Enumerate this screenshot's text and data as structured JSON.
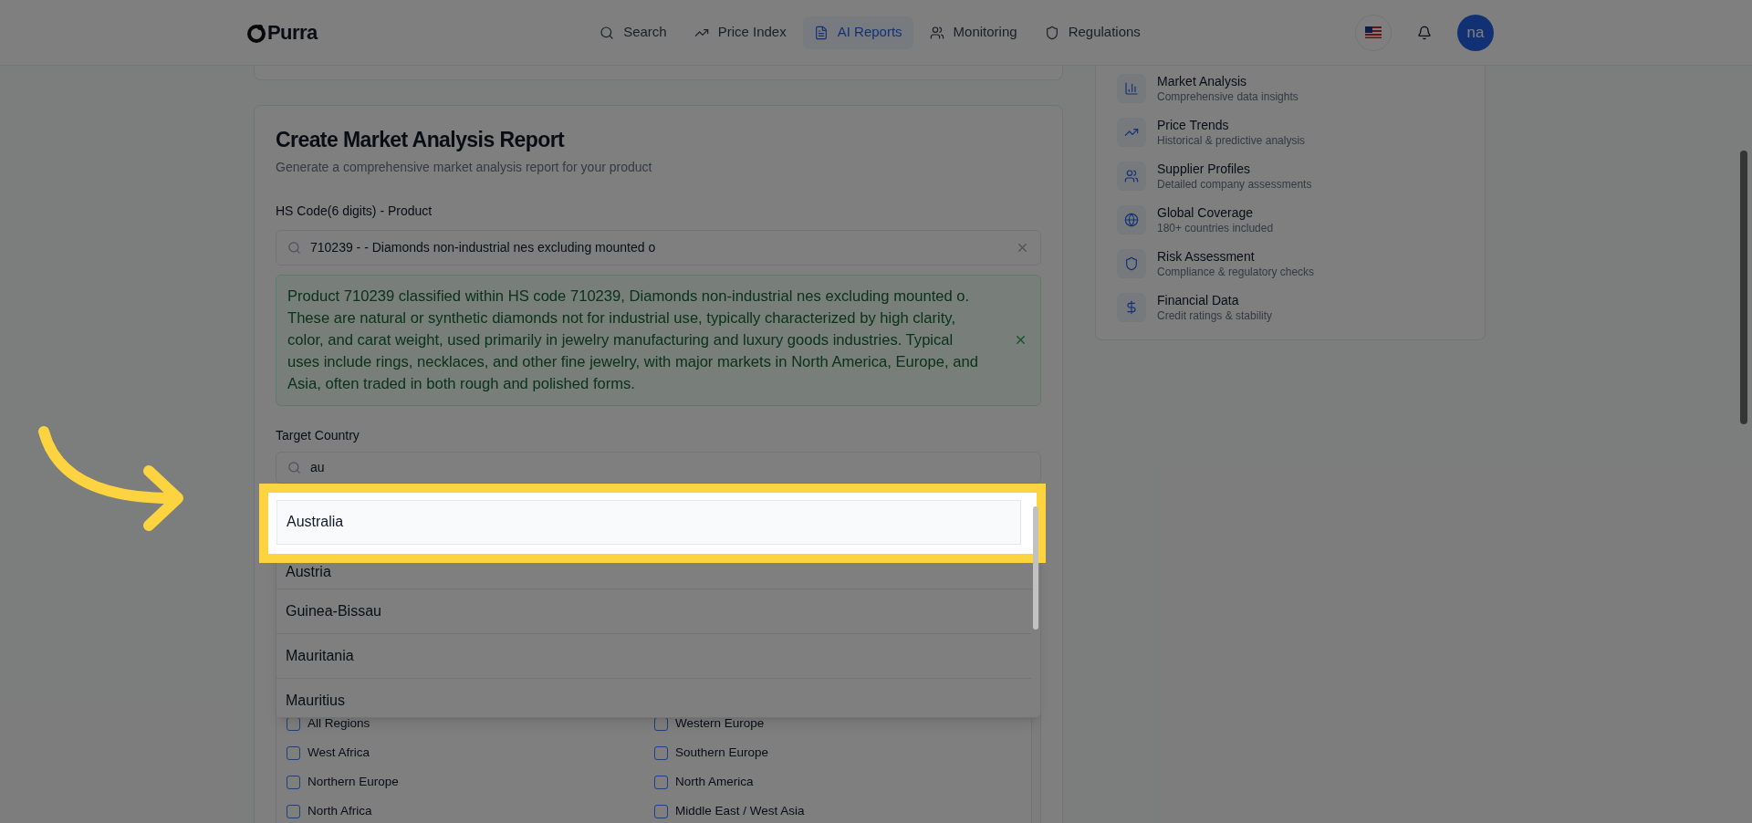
{
  "logo": {
    "text": "Purra"
  },
  "nav": [
    {
      "label": "Search",
      "selected": false
    },
    {
      "label": "Price Index",
      "selected": false
    },
    {
      "label": "AI Reports",
      "selected": true
    },
    {
      "label": "Monitoring",
      "selected": false
    },
    {
      "label": "Regulations",
      "selected": false
    }
  ],
  "avatar": {
    "initials": "na"
  },
  "report_form": {
    "title": "Create Market Analysis Report",
    "subtitle": "Generate a comprehensive market analysis report for your product",
    "hs_code": {
      "label": "HS Code(6 digits) - Product",
      "value": "710239 - - Diamonds non-industrial nes excluding mounted o"
    },
    "description": "Product 710239 classified within HS code 710239, Diamonds non-industrial nes excluding mounted o. These are natural or synthetic diamonds not for industrial use, typically characterized by high clarity, color, and carat weight, used primarily in jewelry manufacturing and luxury goods industries. Typical uses include rings, necklaces, and other fine jewelry, with major markets in North America, Europe, and Asia, often traded in both rough and polished forms.",
    "target_country": {
      "label": "Target Country",
      "value": "au"
    },
    "country_options": [
      {
        "label": "Australia",
        "selected": true
      },
      {
        "label": "Austria",
        "selected": false
      },
      {
        "label": "Guinea-Bissau",
        "selected": false
      },
      {
        "label": "Mauritania",
        "selected": false
      },
      {
        "label": "Mauritius",
        "selected": false
      }
    ],
    "regions": [
      {
        "label": "All Regions",
        "checked": false
      },
      {
        "label": "Western Europe",
        "checked": false
      },
      {
        "label": "West Africa",
        "checked": false
      },
      {
        "label": "Southern Europe",
        "checked": false
      },
      {
        "label": "Northern Europe",
        "checked": false
      },
      {
        "label": "North America",
        "checked": false
      },
      {
        "label": "North Africa",
        "checked": false
      },
      {
        "label": "Middle East / West Asia",
        "checked": false
      }
    ]
  },
  "features": [
    {
      "title": "Market Analysis",
      "subtitle": "Comprehensive data insights"
    },
    {
      "title": "Price Trends",
      "subtitle": "Historical & predictive analysis"
    },
    {
      "title": "Supplier Profiles",
      "subtitle": "Detailed company assessments"
    },
    {
      "title": "Global Coverage",
      "subtitle": "180+ countries included"
    },
    {
      "title": "Risk Assessment",
      "subtitle": "Compliance & regulatory checks"
    },
    {
      "title": "Financial Data",
      "subtitle": "Credit ratings & stability"
    }
  ]
}
